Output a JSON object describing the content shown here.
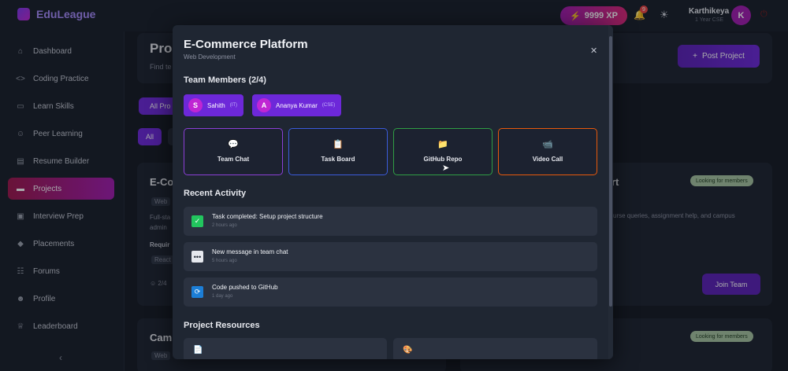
{
  "app": {
    "name": "EduLeague"
  },
  "topbar": {
    "xp": "9999 XP",
    "notification_count": "9",
    "user_name": "Karthikeya",
    "user_sub": "1 Year CSE",
    "avatar_letter": "K"
  },
  "sidebar": {
    "items": [
      {
        "label": "Dashboard",
        "icon": "home-icon"
      },
      {
        "label": "Coding Practice",
        "icon": "code-icon"
      },
      {
        "label": "Learn Skills",
        "icon": "book-icon"
      },
      {
        "label": "Peer Learning",
        "icon": "users-icon"
      },
      {
        "label": "Resume Builder",
        "icon": "document-icon"
      },
      {
        "label": "Projects",
        "icon": "folder-icon",
        "active": true
      },
      {
        "label": "Interview Prep",
        "icon": "briefcase-icon"
      },
      {
        "label": "Placements",
        "icon": "graduation-icon"
      },
      {
        "label": "Forums",
        "icon": "forum-icon"
      },
      {
        "label": "Profile",
        "icon": "user-icon"
      },
      {
        "label": "Leaderboard",
        "icon": "trophy-icon"
      }
    ]
  },
  "background": {
    "page_title": "Pro",
    "page_sub": "Find te",
    "post_button": "Post Project",
    "filter_all_projects": "All Pro",
    "filter_all": "All",
    "card1_title": "E-Co",
    "card1_tag": "Web",
    "card1_text_a": "Full-sta",
    "card1_text_b": "admin",
    "card1_req": "Requir",
    "card1_tech": "React",
    "card1_members": "2/4",
    "card2_title_tail": "rt",
    "card2_status": "Looking for members",
    "card2_desc": "urse queries, assignment help, and campus",
    "card2_join": "Join Team",
    "card3_title": "Cam",
    "card3_tag": "Web",
    "card4_status": "Looking for members"
  },
  "modal": {
    "title": "E-Commerce Platform",
    "subtitle": "Web Development",
    "team_heading": "Team Members (2/4)",
    "members": [
      {
        "initial": "S",
        "name": "Sahith",
        "role": "(IT)"
      },
      {
        "initial": "A",
        "name": "Ananya Kumar",
        "role": "(CSE)"
      }
    ],
    "actions": [
      {
        "label": "Team Chat",
        "icon": "chat-icon",
        "border": "#8b3fd6"
      },
      {
        "label": "Task Board",
        "icon": "clipboard-icon",
        "border": "#3b5bdb"
      },
      {
        "label": "GitHub Repo",
        "icon": "folder-icon",
        "border": "#2f9e44"
      },
      {
        "label": "Video Call",
        "icon": "video-icon",
        "border": "#e8590c"
      }
    ],
    "activity_heading": "Recent Activity",
    "activities": [
      {
        "text": "Task completed: Setup project structure",
        "time": "2 hours ago",
        "icon": "check-icon"
      },
      {
        "text": "New message in team chat",
        "time": "5 hours ago",
        "icon": "message-icon"
      },
      {
        "text": "Code pushed to GitHub",
        "time": "1 day ago",
        "icon": "sync-icon"
      }
    ],
    "resources_heading": "Project Resources"
  },
  "colors": {
    "accent": "#6d28d9",
    "active_nav": "#a21caf",
    "success": "#22c55e"
  }
}
